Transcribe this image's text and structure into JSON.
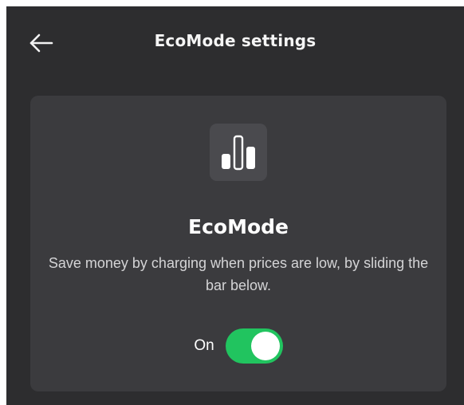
{
  "header": {
    "back_icon": "arrow-left-icon",
    "title": "EcoMode settings"
  },
  "card": {
    "icon": "bar-chart-icon",
    "title": "EcoMode",
    "description": "Save money by charging when prices are low, by sliding the bar below.",
    "toggle": {
      "label": "On",
      "state": true,
      "active_color": "#21c45f"
    }
  },
  "colors": {
    "background": "#2d2d2f",
    "card": "#3b3b3e",
    "icon_tile": "#4a4a4e"
  }
}
